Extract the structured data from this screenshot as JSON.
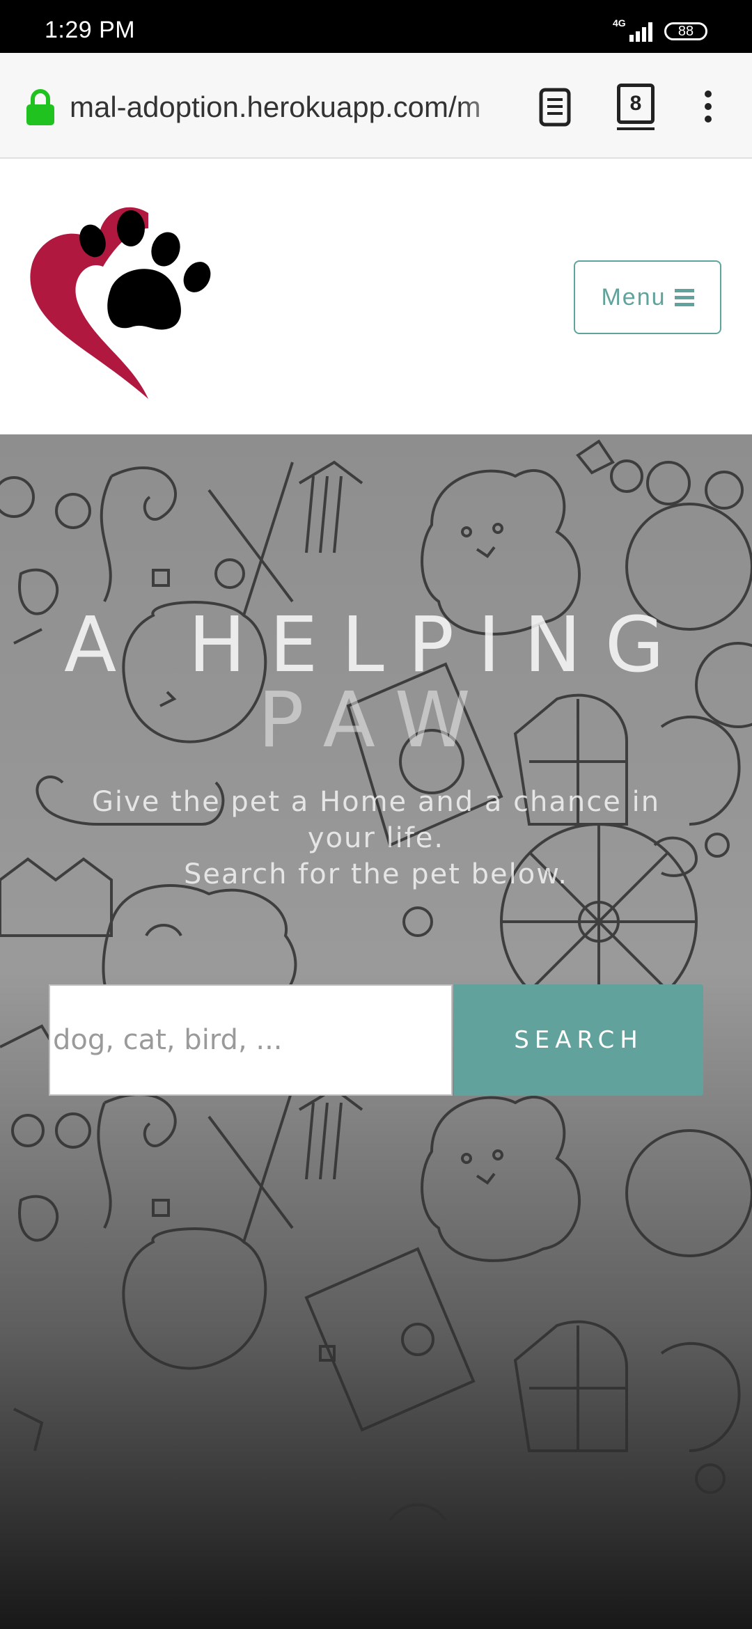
{
  "status_bar": {
    "time": "1:29 PM",
    "network": "4G",
    "battery": "88"
  },
  "browser": {
    "url": "mal-adoption.herokuapp.com/m",
    "tab_count": "8",
    "lock_color": "#1fc21f"
  },
  "header": {
    "menu_label": "Menu",
    "accent_color": "#5fa39c"
  },
  "hero": {
    "title_line1": "A HELPING",
    "title_line2": "PAW",
    "subtitle_line1": "Give the pet a Home and a chance in your life.",
    "subtitle_line2": "Search for the pet below.",
    "search_placeholder": "dog, cat, bird, ...",
    "search_button": "SEARCH"
  }
}
